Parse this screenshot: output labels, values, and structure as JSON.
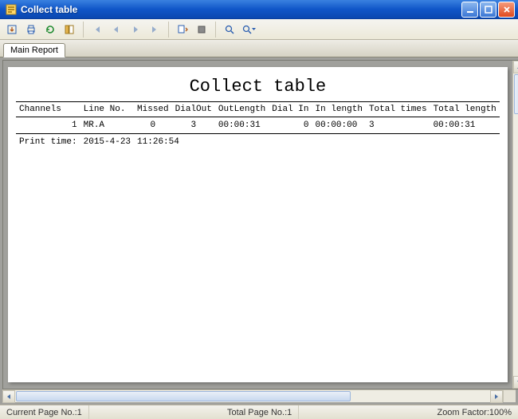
{
  "window": {
    "title": "Collect table"
  },
  "tabs": {
    "main": "Main Report"
  },
  "report": {
    "title": "Collect table",
    "headers": [
      "Channels",
      "Line No.",
      "Missed",
      "DialOut",
      "OutLength",
      "Dial In",
      "In length",
      "Total times",
      "Total length"
    ],
    "rows": [
      {
        "channels": "1",
        "line_no": "MR.A",
        "missed": "0",
        "dialout": "3",
        "outlength": "00:00:31",
        "dialin": "0",
        "inlength": "00:00:00",
        "total_times": "3",
        "total_length": "00:00:31"
      }
    ],
    "print_time_label": "Print time:",
    "print_date": "2015-4-23",
    "print_clock": "11:26:54"
  },
  "status": {
    "current_page_label": "Current Page No.: ",
    "current_page": "1",
    "total_page_label": "Total Page No.: ",
    "total_page": "1",
    "zoom_label": "Zoom Factor: ",
    "zoom": "100%"
  }
}
